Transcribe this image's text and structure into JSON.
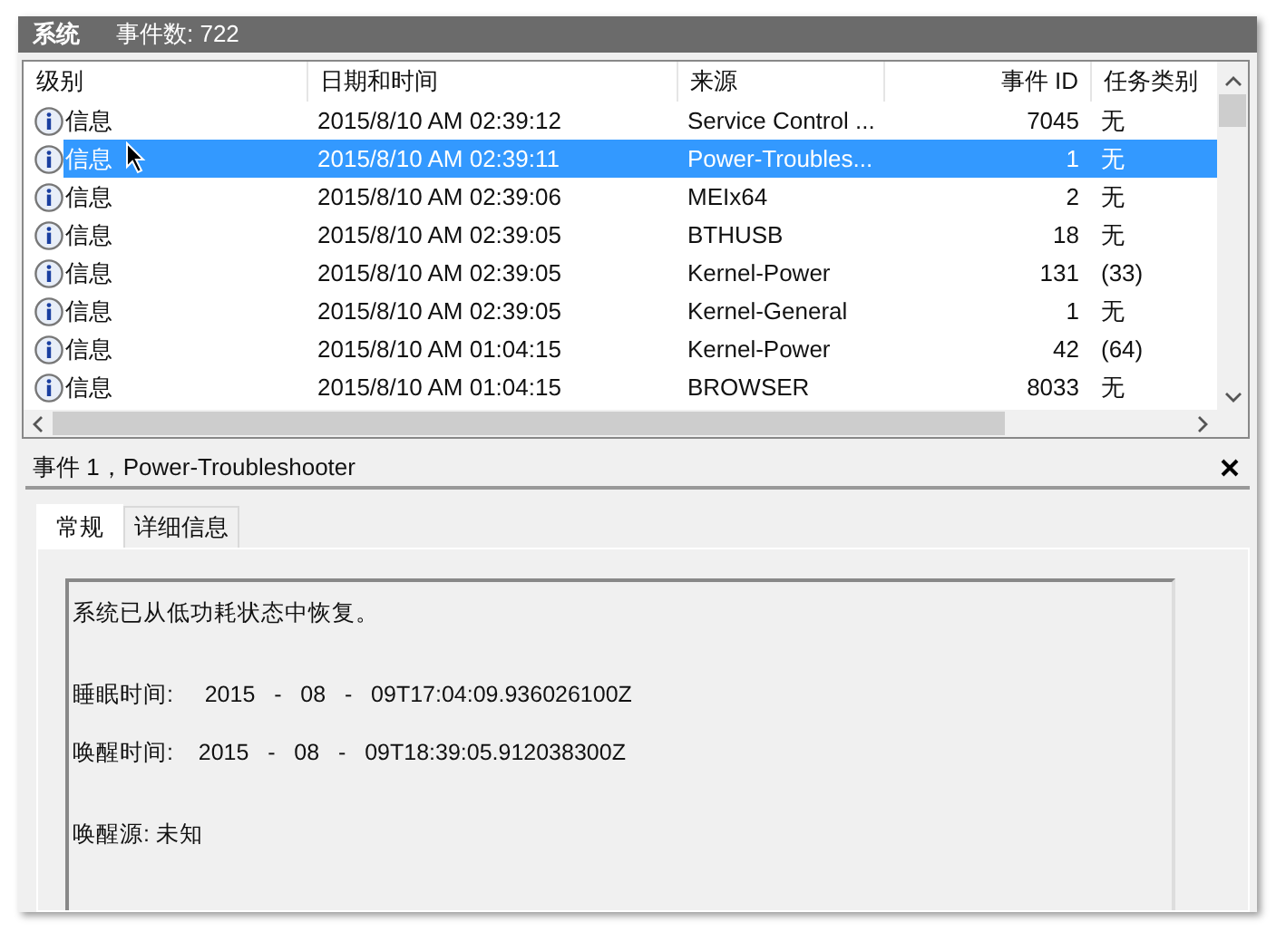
{
  "header": {
    "log_name": "系统",
    "event_count": "事件数: 722"
  },
  "table": {
    "columns": [
      "级别",
      "日期和时间",
      "来源",
      "事件 ID",
      "任务类别"
    ],
    "rows": [
      {
        "level": "信息",
        "datetime": "2015/8/10 AM 02:39:12",
        "source": "Service Control ...",
        "event_id": "7045",
        "task": "无",
        "selected": false
      },
      {
        "level": "信息",
        "datetime": "2015/8/10 AM 02:39:11",
        "source": "Power-Troubles...",
        "event_id": "1",
        "task": "无",
        "selected": true
      },
      {
        "level": "信息",
        "datetime": "2015/8/10 AM 02:39:06",
        "source": "MEIx64",
        "event_id": "2",
        "task": "无",
        "selected": false
      },
      {
        "level": "信息",
        "datetime": "2015/8/10 AM 02:39:05",
        "source": "BTHUSB",
        "event_id": "18",
        "task": "无",
        "selected": false
      },
      {
        "level": "信息",
        "datetime": "2015/8/10 AM 02:39:05",
        "source": "Kernel-Power",
        "event_id": "131",
        "task": "(33)",
        "selected": false
      },
      {
        "level": "信息",
        "datetime": "2015/8/10 AM 02:39:05",
        "source": "Kernel-General",
        "event_id": "1",
        "task": "无",
        "selected": false
      },
      {
        "level": "信息",
        "datetime": "2015/8/10 AM 01:04:15",
        "source": "Kernel-Power",
        "event_id": "42",
        "task": "(64)",
        "selected": false
      },
      {
        "level": "信息",
        "datetime": "2015/8/10 AM 01:04:15",
        "source": "BROWSER",
        "event_id": "8033",
        "task": "无",
        "selected": false
      }
    ]
  },
  "detail": {
    "title": "事件 1，Power-Troubleshooter",
    "tabs": [
      {
        "label": "常规",
        "selected": true
      },
      {
        "label": "详细信息",
        "selected": false
      }
    ],
    "paragraphs": [
      [
        "系统已从低功耗状态中恢复。"
      ],
      [
        "睡眠时间:     2015   -   08   -   09T17:04:09.936026100Z",
        "唤醒时间:    2015   -   08   -   09T18:39:05.912038300Z"
      ],
      [
        "唤醒源: 未知"
      ]
    ]
  }
}
